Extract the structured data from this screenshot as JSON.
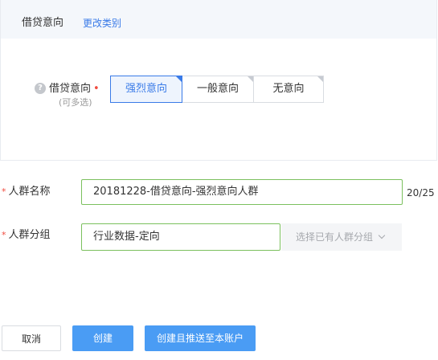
{
  "header": {
    "title": "借贷意向",
    "change_link": "更改类别"
  },
  "intent": {
    "label": "借贷意向",
    "required_mark": "•",
    "sub_label": "(可多选)",
    "help_glyph": "?",
    "options": [
      {
        "label": "强烈意向",
        "selected": true
      },
      {
        "label": "一般意向",
        "selected": false
      },
      {
        "label": "无意向",
        "selected": false
      }
    ]
  },
  "form": {
    "name_label": "人群名称",
    "name_value": "20181228-借贷意向-强烈意向人群",
    "name_counter": "20/25",
    "group_label": "人群分组",
    "group_value": "行业数据-定向",
    "group_select_placeholder": "选择已有人群分组",
    "required_star": "*"
  },
  "actions": {
    "cancel": "取消",
    "create": "创建",
    "create_and_push": "创建且推送至本账户"
  },
  "colors": {
    "accent": "#3a7be8",
    "primary_button": "#4a9cf4",
    "input_valid_border": "#7bc05e",
    "required": "#f04b3e"
  }
}
